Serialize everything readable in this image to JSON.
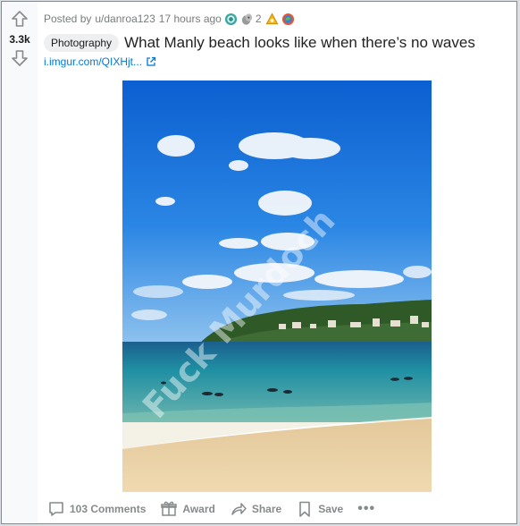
{
  "post": {
    "score": "3.3k",
    "meta": {
      "posted_by": "Posted by",
      "username": "u/danroa123",
      "time": "17 hours ago",
      "award_multi_count": "2"
    },
    "flair": "Photography",
    "title": "What Manly beach looks like when there’s no waves",
    "link_text": "i.imgur.com/QIXHjt...",
    "watermark": "Fuck Murdoch"
  },
  "actions": {
    "comments": "103 Comments",
    "award": "Award",
    "share": "Share",
    "save": "Save",
    "more": "•••"
  },
  "icons": {
    "upvote": "upvote-arrow-icon",
    "downvote": "downvote-arrow-icon",
    "external_link": "external-link-icon",
    "comment": "comment-bubble-icon",
    "gift": "gift-icon",
    "share": "share-arrow-icon",
    "bookmark": "bookmark-icon"
  },
  "colors": {
    "link": "#0079d3",
    "meta": "#787c7e",
    "action": "#878a8c",
    "sky": "#1a6fd6",
    "sea": "#2a7fa0",
    "sand": "#e8cfa4"
  }
}
